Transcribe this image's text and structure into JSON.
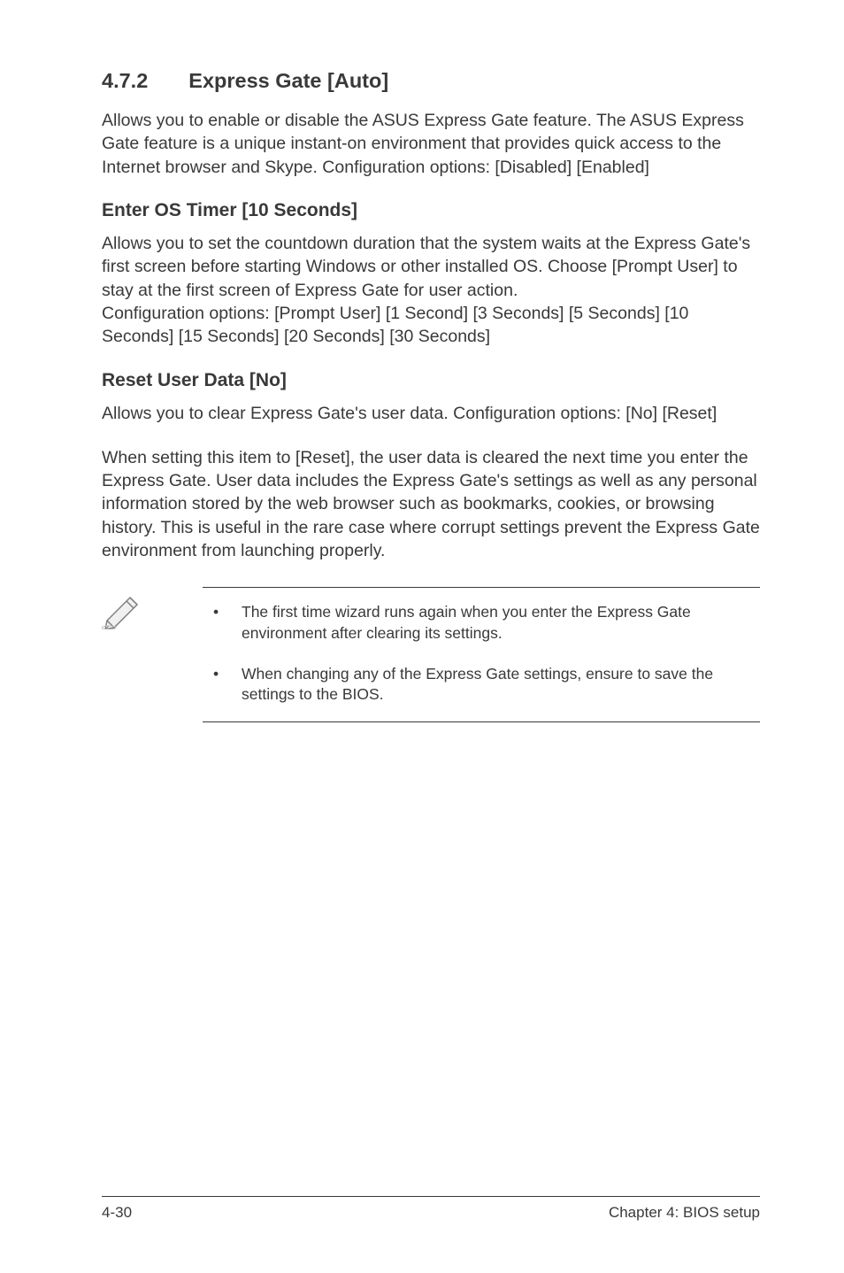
{
  "section": {
    "number": "4.7.2",
    "title": "Express Gate [Auto]",
    "intro": "Allows you to enable or disable the ASUS Express Gate feature. The ASUS Express Gate feature is a unique instant-on environment that provides quick access to the Internet browser and Skype. Configuration options: [Disabled] [Enabled]"
  },
  "sub1": {
    "heading": "Enter OS Timer [10 Seconds]",
    "body": "Allows you to set the countdown duration that the system waits at the Express Gate's first screen before starting Windows or other installed OS. Choose [Prompt User] to stay at the first screen of Express Gate for user action.\nConfiguration options: [Prompt User] [1 Second] [3 Seconds] [5 Seconds] [10 Seconds] [15 Seconds] [20 Seconds] [30 Seconds]"
  },
  "sub2": {
    "heading": "Reset User Data [No]",
    "body1": "Allows you to clear Express Gate's user data. Configuration options: [No] [Reset]",
    "body2": "When setting this item to [Reset], the user data is cleared the next time you enter the Express Gate. User data includes the Express Gate's settings as well as any personal information stored by the web browser such as bookmarks, cookies, or browsing history. This is useful in the rare case where corrupt settings prevent the Express Gate environment from launching properly."
  },
  "notes": {
    "item1": "The first time wizard runs again when you enter the Express Gate environment after clearing its settings.",
    "item2": "When changing any of the Express Gate settings, ensure to save the settings to the BIOS."
  },
  "footer": {
    "left": "4-30",
    "right": "Chapter 4: BIOS setup"
  }
}
